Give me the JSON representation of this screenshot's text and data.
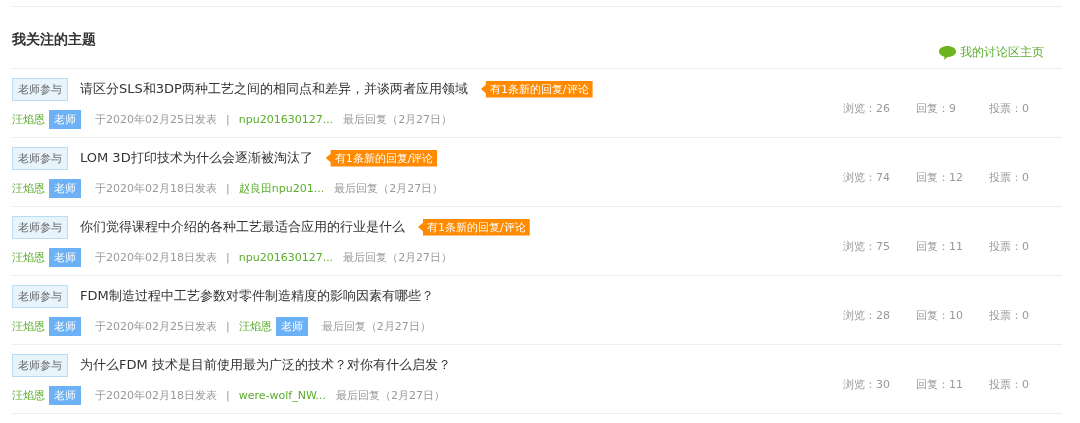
{
  "section_title": "我关注的主题",
  "home_link": "我的讨论区主页",
  "topics": [
    {
      "tag": "老师参与",
      "title": "请区分SLS和3DP两种工艺之间的相同点和差异，并谈两者应用领域",
      "new_notice": "有1条新的回复/评论",
      "author": "汪焰恩",
      "author_teacher_badge": "老师",
      "posted": "于2020年02月25日发表",
      "separator": "|",
      "last_replier": "npu201630127...",
      "last_reply": "最后回复（2月27日）",
      "views": "浏览：26",
      "replies": "回复：9",
      "votes": "投票：0"
    },
    {
      "tag": "老师参与",
      "title": "LOM 3D打印技术为什么会逐渐被淘汰了",
      "new_notice": "有1条新的回复/评论",
      "author": "汪焰恩",
      "author_teacher_badge": "老师",
      "posted": "于2020年02月18日发表",
      "separator": "|",
      "last_replier": "赵良田npu201...",
      "last_reply": "最后回复（2月27日）",
      "views": "浏览：74",
      "replies": "回复：12",
      "votes": "投票：0"
    },
    {
      "tag": "老师参与",
      "title": "你们觉得课程中介绍的各种工艺最适合应用的行业是什么",
      "new_notice": "有1条新的回复/评论",
      "author": "汪焰恩",
      "author_teacher_badge": "老师",
      "posted": "于2020年02月18日发表",
      "separator": "|",
      "last_replier": "npu201630127...",
      "last_reply": "最后回复（2月27日）",
      "views": "浏览：75",
      "replies": "回复：11",
      "votes": "投票：0"
    },
    {
      "tag": "老师参与",
      "title": "FDM制造过程中工艺参数对零件制造精度的影响因素有哪些？",
      "author": "汪焰恩",
      "author_teacher_badge": "老师",
      "posted": "于2020年02月25日发表",
      "separator": "|",
      "last_replier": "汪焰恩",
      "last_replier_teacher_badge": "老师",
      "last_reply": "最后回复（2月27日）",
      "views": "浏览：28",
      "replies": "回复：10",
      "votes": "投票：0"
    },
    {
      "tag": "老师参与",
      "title": "为什么FDM 技术是目前使用最为广泛的技术？对你有什么启发？",
      "author": "汪焰恩",
      "author_teacher_badge": "老师",
      "posted": "于2020年02月18日发表",
      "separator": "|",
      "last_replier": "were-wolf_NW...",
      "last_reply": "最后回复（2月27日）",
      "views": "浏览：30",
      "replies": "回复：11",
      "votes": "投票：0"
    }
  ]
}
